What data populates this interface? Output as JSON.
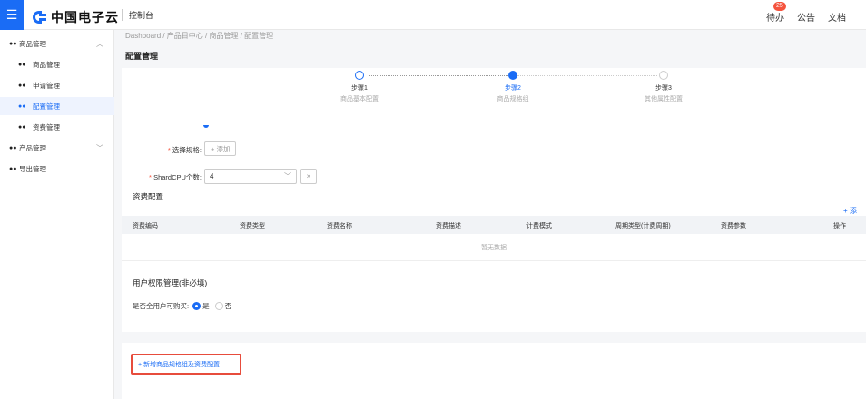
{
  "topbar": {
    "menu_icon": "hamburger-icon",
    "brand": "中国电子云",
    "console": "控制台",
    "todo_label": "待办",
    "todo_badge": "25",
    "notice_label": "公告",
    "docs_label": "文档"
  },
  "sidebar": {
    "items": [
      {
        "label": "商品管理",
        "icon": "group-icon",
        "expandable": true,
        "expanded": true
      },
      {
        "label": "商品管理",
        "icon": "group-icon"
      },
      {
        "label": "申请管理",
        "icon": "group-icon"
      },
      {
        "label": "配置管理",
        "icon": "group-icon",
        "active": true
      },
      {
        "label": "资费管理",
        "icon": "group-icon"
      },
      {
        "label": "产品管理",
        "icon": "group-icon",
        "expandable": true,
        "expanded": false
      },
      {
        "label": "导出管理",
        "icon": "group-icon"
      }
    ]
  },
  "breadcrumb": {
    "path": "Dashboard  /  产品目中心  /  商品管理  /  配置管理"
  },
  "page": {
    "title": "配置管理"
  },
  "steps": [
    {
      "label": "步骤1",
      "sub": "商品基本配置",
      "state": "done"
    },
    {
      "label": "步骤2",
      "sub": "商品规格组",
      "state": "active"
    },
    {
      "label": "步骤3",
      "sub": "其他属性配置",
      "state": "pending"
    }
  ],
  "form": {
    "spec_label": "选择规格:",
    "spec_add": "+ 添加",
    "cpu_label": "ShardCPU个数:",
    "cpu_value": "4",
    "clear_symbol": "×"
  },
  "fees": {
    "title": "资费配置",
    "add_label": "+ 添",
    "columns": [
      "资费编码",
      "资费类型",
      "资费名称",
      "资费描述",
      "计费模式",
      "周期类型(计费周期)",
      "资费参数",
      "操作"
    ],
    "empty_text": "暂无数据"
  },
  "permissions": {
    "title": "用户权限管理(非必填)",
    "question": "是否全用户可购买:",
    "options": [
      {
        "label": "是",
        "selected": true
      },
      {
        "label": "否",
        "selected": false
      }
    ]
  },
  "bottom": {
    "new_button": "+ 新增商品规格组及资费配置"
  },
  "colors": {
    "primary": "#1a6cf5",
    "highlight_border": "#e74c3c",
    "badge": "#f5533d"
  }
}
